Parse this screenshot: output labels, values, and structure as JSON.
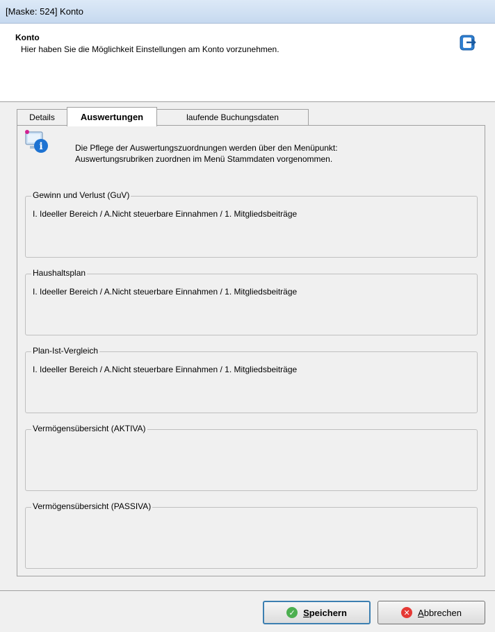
{
  "window": {
    "title": "[Maske: 524] Konto"
  },
  "header": {
    "title": "Konto",
    "subtitle": "Hier haben Sie die Möglichkeit Einstellungen am Konto vorzunehmen.",
    "icon": "exit-door-icon"
  },
  "tabs": [
    {
      "label": "Details",
      "active": false
    },
    {
      "label": "Auswertungen",
      "active": true
    },
    {
      "label": "laufende Buchungsdaten",
      "active": false
    }
  ],
  "info": {
    "icon": "computer-info-icon",
    "line1": "Die Pflege der Auswertungszuordnungen werden über den Menüpunkt:",
    "line2": "Auswertungsrubriken zuordnen im Menü Stammdaten vorgenommen."
  },
  "groups": [
    {
      "label": "Gewinn und Verlust (GuV)",
      "value": "I. Ideeller Bereich / A.Nicht steuerbare Einnahmen / 1. Mitgliedsbeiträge"
    },
    {
      "label": "Haushaltsplan",
      "value": "I. Ideeller Bereich / A.Nicht steuerbare Einnahmen / 1. Mitgliedsbeiträge"
    },
    {
      "label": "Plan-Ist-Vergleich",
      "value": "I. Ideeller Bereich / A.Nicht steuerbare Einnahmen / 1. Mitgliedsbeiträge"
    },
    {
      "label": "Vermögensübersicht (AKTIVA)",
      "value": ""
    },
    {
      "label": "Vermögensübersicht (PASSIVA)",
      "value": ""
    }
  ],
  "buttons": {
    "save": {
      "label_first": "S",
      "label_rest": "peichern",
      "icon": "check-icon",
      "icon_color": "#4caf50"
    },
    "cancel": {
      "label_first": "A",
      "label_rest": "bbrechen",
      "icon": "close-icon",
      "icon_color": "#e53935"
    }
  }
}
